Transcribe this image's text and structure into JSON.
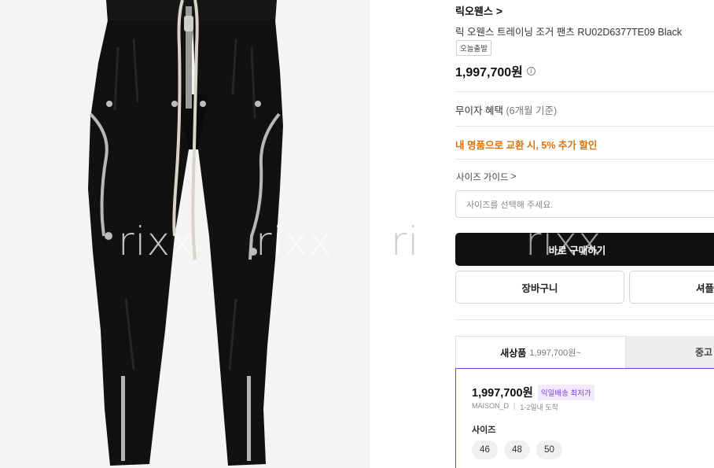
{
  "product": {
    "brand": "릭오웬스",
    "brand_chevron": ">",
    "name": "릭 오웬스 트레이닝 조거 팬츠 RU02D6377TE09 Black",
    "badge": "오늘출발",
    "price": "1,997,700원",
    "price_info_icon": "i"
  },
  "watermark": [
    "rixx",
    "rixx",
    "rixx",
    "rixx"
  ],
  "benefits": {
    "interest_free": "무이자 혜택",
    "interest_free_sub": "(6개월 기준)",
    "promo": "내 명품으로 교환 시, 5% 추가 할인"
  },
  "size_guide": {
    "label": "사이즈 가이드",
    "chevron": ">"
  },
  "size_select": {
    "placeholder": "사이즈를 선택해 주세요."
  },
  "buttons": {
    "buy_now": "바로 구매하기",
    "cart": "장바구니",
    "share": "셔플"
  },
  "tabs": {
    "new_label": "새상품",
    "new_price": "1,997,700원~",
    "used_label": "중고"
  },
  "offer": {
    "price": "1,997,700원",
    "badge": "익일배송 최저가",
    "seller": "MAISON_D",
    "separator": "|",
    "delivery": "1-2일내 도착",
    "size_label": "사이즈",
    "sizes": [
      "46",
      "48",
      "50"
    ]
  },
  "colors": {
    "accent_purple": "#7b3fd6",
    "promo_orange": "#e0720c",
    "buy_button": "#111111"
  }
}
